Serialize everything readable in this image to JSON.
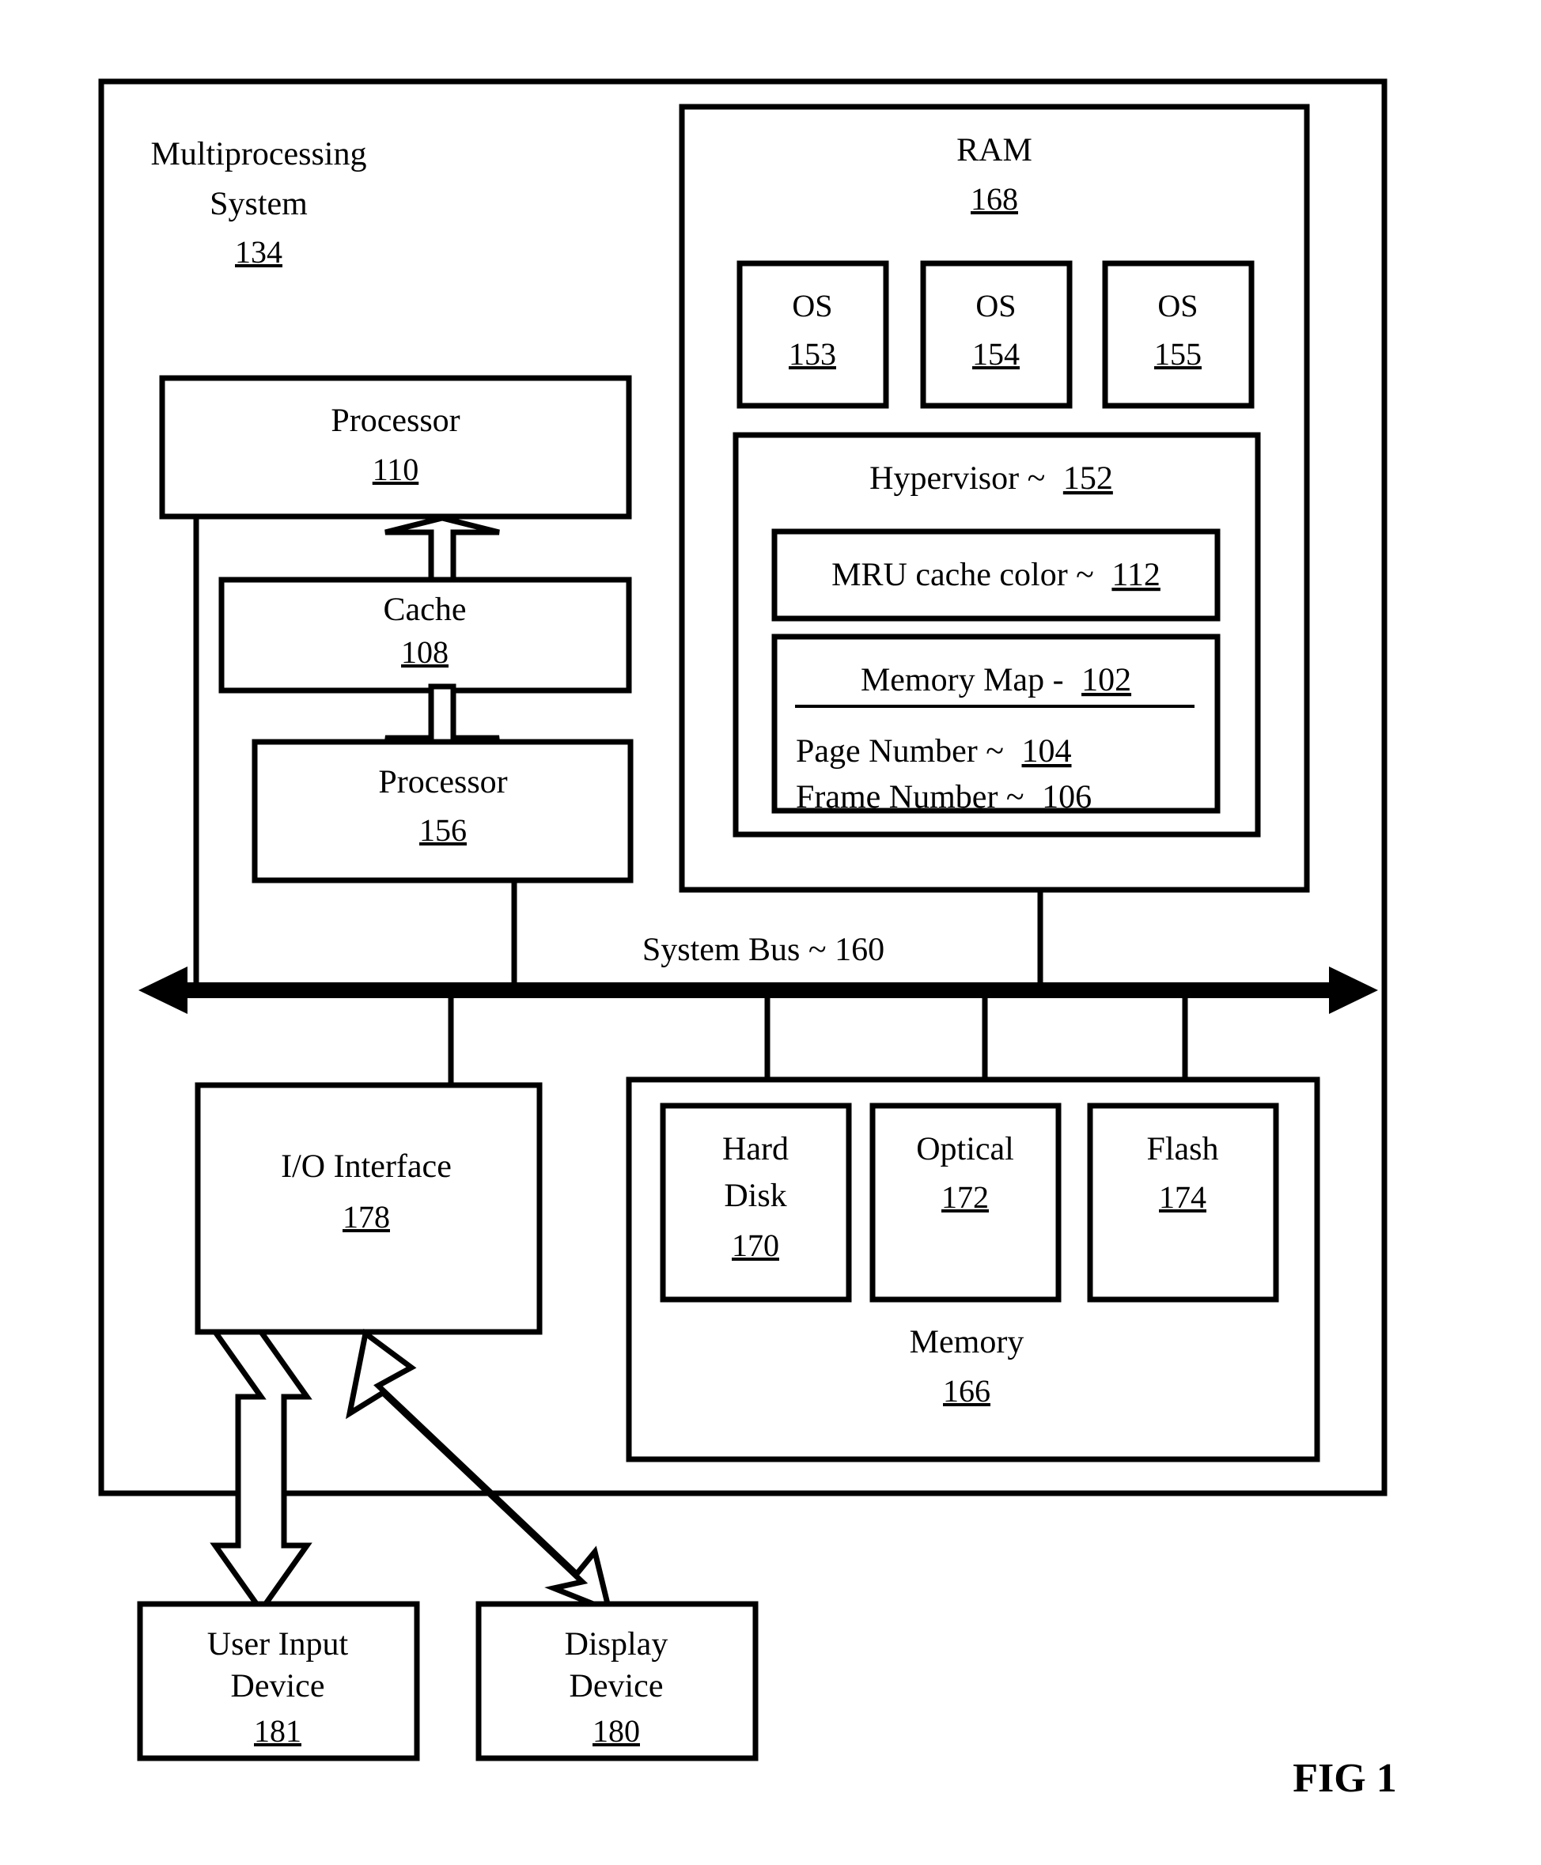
{
  "figure": {
    "caption": "FIG 1",
    "system": {
      "title_line1": "Multiprocessing",
      "title_line2": "System",
      "ref": "134"
    },
    "ram": {
      "label": "RAM",
      "ref": "168",
      "os_blocks": [
        {
          "label": "OS",
          "ref": "153"
        },
        {
          "label": "OS",
          "ref": "154"
        },
        {
          "label": "OS",
          "ref": "155"
        }
      ],
      "hypervisor": {
        "label": "Hypervisor ~",
        "ref": "152",
        "mru": {
          "label": "MRU cache color ~",
          "ref": "112"
        },
        "memory_map": {
          "label": "Memory Map -",
          "ref": "102",
          "rows": [
            {
              "label": "Page Number ~",
              "ref": "104"
            },
            {
              "label": "Frame Number ~",
              "ref": "106"
            }
          ]
        }
      }
    },
    "processors": [
      {
        "label": "Processor",
        "ref": "110"
      },
      {
        "label": "Processor",
        "ref": "156"
      }
    ],
    "cache": {
      "label": "Cache",
      "ref": "108"
    },
    "bus": {
      "label": "System Bus ~ 160"
    },
    "io_interface": {
      "label": "I/O Interface",
      "ref": "178"
    },
    "memory": {
      "label": "Memory",
      "ref": "166",
      "devices": [
        {
          "label_line1": "Hard",
          "label_line2": "Disk",
          "ref": "170"
        },
        {
          "label_line1": "Optical",
          "label_line2": "",
          "ref": "172"
        },
        {
          "label_line1": "Flash",
          "label_line2": "",
          "ref": "174"
        }
      ]
    },
    "peripherals": [
      {
        "label_line1": "User Input",
        "label_line2": "Device",
        "ref": "181"
      },
      {
        "label_line1": "Display",
        "label_line2": "Device",
        "ref": "180"
      }
    ]
  }
}
